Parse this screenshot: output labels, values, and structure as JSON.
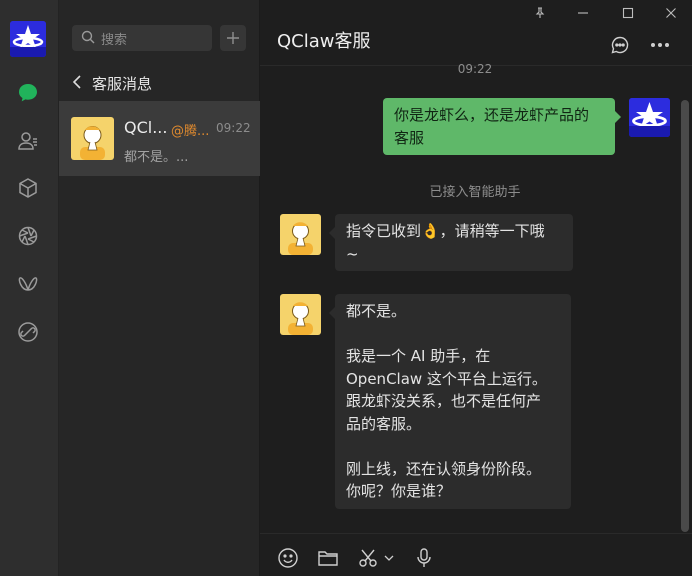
{
  "sidebar": {
    "icons": [
      "app-logo-icon",
      "chat-icon",
      "contacts-icon",
      "box-icon",
      "aperture-icon",
      "butterfly-icon",
      "link-icon"
    ]
  },
  "chat_list": {
    "search_placeholder": "搜索",
    "section_title": "客服消息",
    "conversations": [
      {
        "name": "QCl...",
        "tag": "@腾...",
        "time": "09:22",
        "preview": "都不是。..."
      }
    ]
  },
  "chat": {
    "title": "QClaw客服",
    "timestamp": "09:22",
    "system_notice": "已接入智能助手",
    "messages": [
      {
        "sender": "me",
        "text": "你是龙虾么，还是龙虾产品的\n客服"
      },
      {
        "sender": "bot",
        "text": "指令已收到👌，请稍等一下哦\n~"
      },
      {
        "sender": "bot",
        "text": "都不是。\n\n我是一个 AI 助手，在\nOpenClaw 这个平台上运行。\n跟龙虾没关系，也不是任何产\n品的客服。\n\n刚上线，还在认领身份阶段。\n你呢？你是谁？"
      }
    ]
  },
  "colors": {
    "accent_green": "#5fb869",
    "brand_blue": "#2c2cde",
    "tag_orange": "#e08a2e"
  }
}
